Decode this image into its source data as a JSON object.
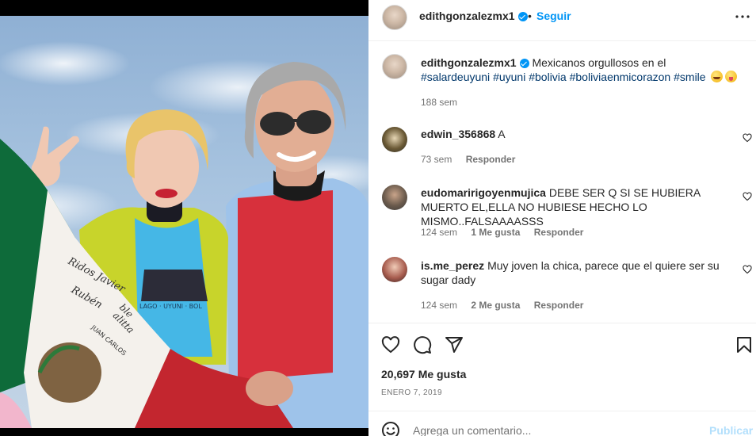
{
  "post": {
    "username": "edithgonzalezmx1",
    "follow_label": "Seguir",
    "dot": "•"
  },
  "caption": {
    "username": "edithgonzalezmx1",
    "text": "Mexicanos orgullosos en el",
    "hashtags": [
      "#salardeuyuni",
      "#uyuni",
      "#bolivia",
      "#boliviaenmicorazon",
      "#smile"
    ],
    "time": "188 sem"
  },
  "comments": [
    {
      "username": "edwin_356868",
      "text": "A",
      "time": "73 sem",
      "likes": "",
      "reply_label": "Responder"
    },
    {
      "username": "eudomaririgoyenmujica",
      "text": "DEBE SER Q SI SE HUBIERA MUERTO EL,ELLA NO HUBIESE HECHO LO MISMO..FALSAAAASSS",
      "time": "124 sem",
      "likes": "1 Me gusta",
      "reply_label": "Responder"
    },
    {
      "username": "is.me_perez",
      "text": "Muy joven la chica, parece que el quiere ser su sugar dady",
      "time": "124 sem",
      "likes": "2 Me gusta",
      "reply_label": "Responder"
    }
  ],
  "stats": {
    "likes": "20,697 Me gusta",
    "date": "ENERO 7, 2019"
  },
  "composer": {
    "placeholder": "Agrega un comentario...",
    "post_label": "Publicar"
  },
  "photo": {
    "flag_writing": [
      "Ridos Javier",
      "Rubén",
      "ble",
      "alitta",
      "JUAN CARLOS"
    ],
    "shirt_text": "LAGO · UYUNI · BOL"
  },
  "colors": {
    "accent": "#0095f6",
    "hashtag": "#00376b",
    "muted": "#737373",
    "post_disabled": "#b2dffc"
  },
  "icons": [
    "verified-icon",
    "more-options-icon",
    "heart-icon",
    "comment-icon",
    "share-icon",
    "bookmark-icon",
    "emoji-icon"
  ]
}
